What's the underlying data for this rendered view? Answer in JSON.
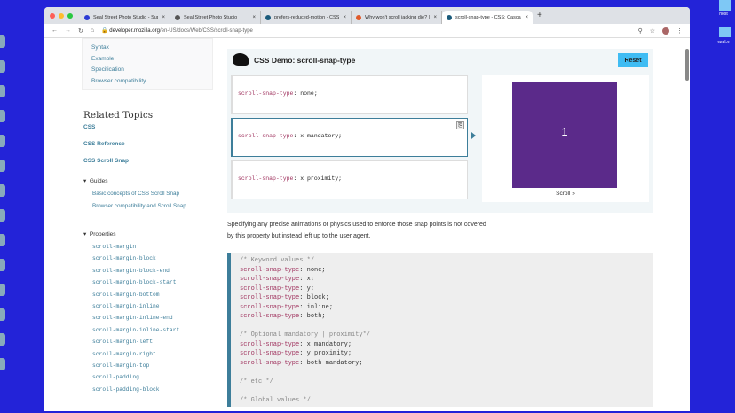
{
  "browser": {
    "tabs": [
      {
        "label": "Seal Street Photo Studio - Sup",
        "color": "#2c3bd4"
      },
      {
        "label": "Seal Street Photo Studio",
        "color": "#555"
      },
      {
        "label": "prefers-reduced-motion - CSS",
        "color": "#1a5a7a"
      },
      {
        "label": "Why won't scroll jacking die? |",
        "color": "#e05a2b"
      },
      {
        "label": "scroll-snap-type - CSS: Casca",
        "color": "#1a5a7a"
      }
    ],
    "url_domain": "developer.mozilla.org",
    "url_path": "/en-US/docs/Web/CSS/scroll-snap-type"
  },
  "toc": [
    "Syntax",
    "Example",
    "Specification",
    "Browser compatibility"
  ],
  "related": {
    "heading": "Related Topics",
    "top_links": [
      "CSS",
      "CSS Reference",
      "CSS Scroll Snap"
    ],
    "guides_label": "Guides",
    "guides": [
      "Basic concepts of CSS Scroll Snap",
      "Browser compatibility and Scroll Snap"
    ],
    "properties_label": "Properties",
    "properties": [
      "scroll-margin",
      "scroll-margin-block",
      "scroll-margin-block-end",
      "scroll-margin-block-start",
      "scroll-margin-bottom",
      "scroll-margin-inline",
      "scroll-margin-inline-end",
      "scroll-margin-inline-start",
      "scroll-margin-left",
      "scroll-margin-right",
      "scroll-margin-top",
      "scroll-padding",
      "scroll-padding-block"
    ]
  },
  "demo": {
    "title": "CSS Demo: scroll-snap-type",
    "reset": "Reset",
    "choices": [
      {
        "prop": "scroll-snap-type",
        "value": "none;"
      },
      {
        "prop": "scroll-snap-type",
        "value": "x mandatory;"
      },
      {
        "prop": "scroll-snap-type",
        "value": "x proximity;"
      }
    ],
    "box_number": "1",
    "scroll_label": "Scroll »"
  },
  "paragraph": [
    "Specifying any precise animations or physics used to enforce those snap points is not covered",
    "by this property but instead left up to the user agent."
  ],
  "code": {
    "comment1": "/* Keyword values */",
    "prop": "scroll-snap-type",
    "keywords": [
      "none;",
      "x;",
      "y;",
      "block;",
      "inline;",
      "both;"
    ],
    "comment2": "/* Optional mandatory | proximity*/",
    "optional": [
      "x mandatory;",
      "y proximity;",
      "both mandatory;"
    ],
    "comment3": "/* etc */",
    "comment4": "/* Global values */"
  },
  "desktop": {
    "labels": [
      "host",
      "seal-s"
    ]
  }
}
